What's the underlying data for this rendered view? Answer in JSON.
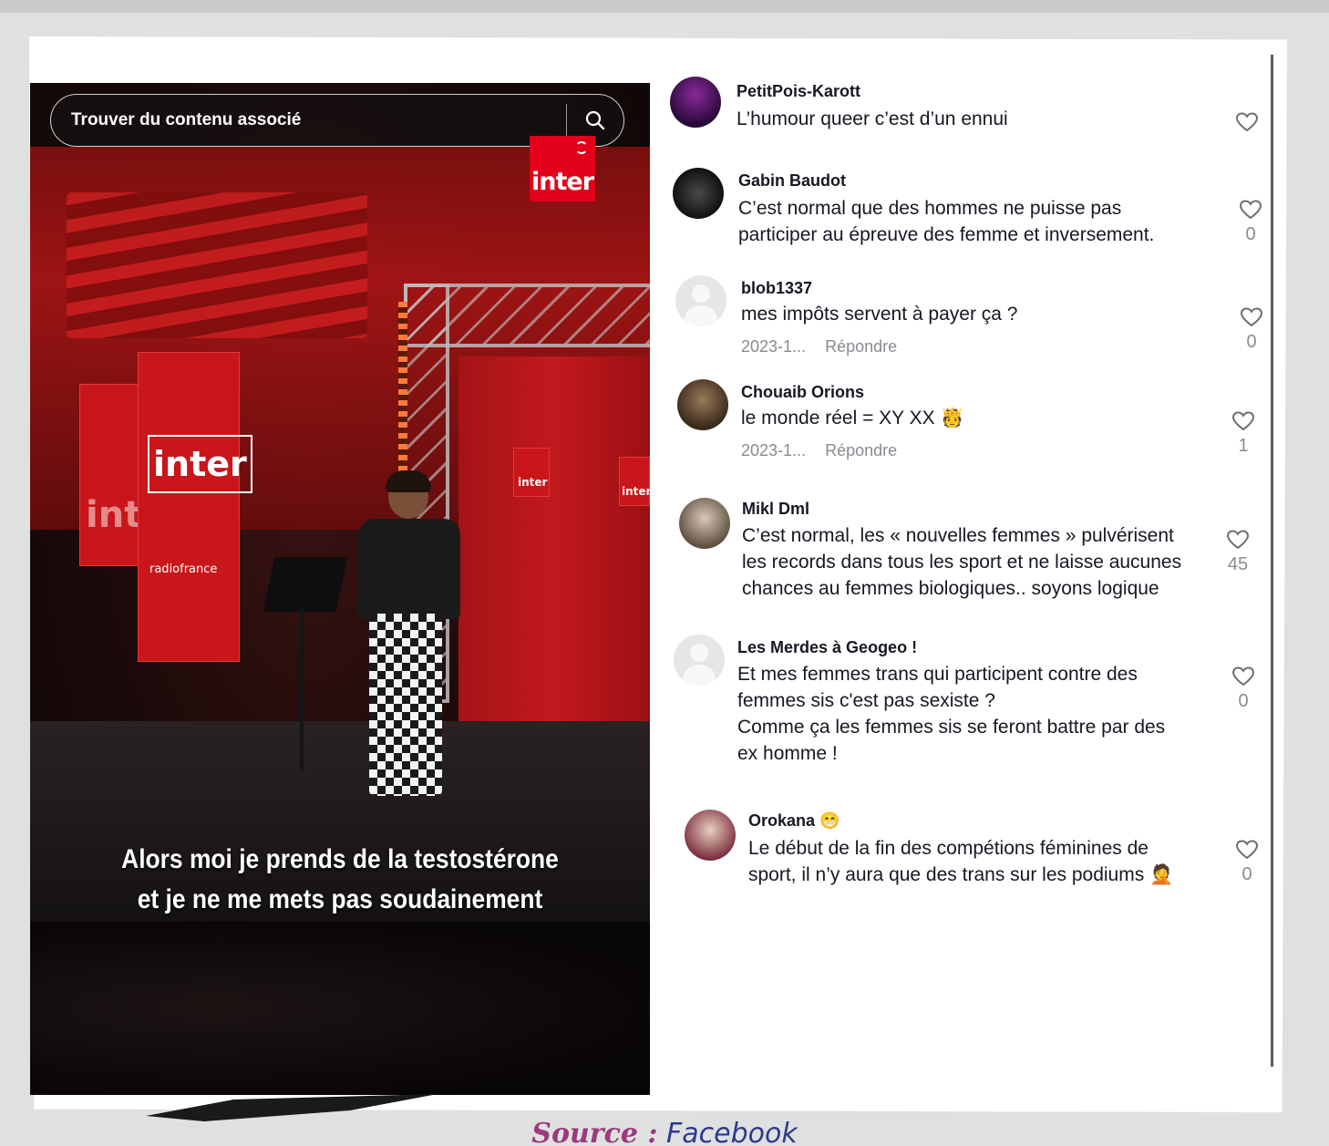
{
  "video": {
    "search_placeholder": "Trouver du contenu associé",
    "logo_text": "inter",
    "subtitle_line1": "Alors moi je prends de la testostérone",
    "subtitle_line2": "et je ne me mets pas soudainement",
    "banner_text": "inter",
    "banner_sub": "radiofrance"
  },
  "comments": [
    {
      "user": "PetitPois-Karott",
      "text": "L’humour queer c’est d’un ennui",
      "date": "",
      "reply": "",
      "likes": ""
    },
    {
      "user": "Gabin Baudot",
      "text": "C’est normal que des hommes ne puisse pas\nparticiper au épreuve des femme et inversement.",
      "date": "",
      "reply": "",
      "likes": "0"
    },
    {
      "user": "blob1337",
      "text": "mes impôts servent à payer ça ?",
      "date": "2023-1...",
      "reply": "Répondre",
      "likes": "0"
    },
    {
      "user": "Chouaib Orions",
      "text": "le monde réel = XY XX 🫅",
      "date": "2023-1...",
      "reply": "Répondre",
      "likes": "1"
    },
    {
      "user": "Mikl Dml",
      "text": "C’est normal, les « nouvelles femmes » pulvérisent\nles records dans tous les sport et ne laisse aucunes\nchances au femmes biologiques.. soyons logique",
      "date": "",
      "reply": "",
      "likes": "45"
    },
    {
      "user": "Les Merdes à Geogeo !",
      "text": "Et mes femmes trans qui participent contre des\nfemmes sis c'est pas sexiste ?\nComme ça les femmes sis se feront battre par des\nex homme !",
      "date": "",
      "reply": "",
      "likes": "0"
    },
    {
      "user": "Orokana 😁",
      "text": "Le début de la fin des compétions féminines de\nsport, il n’y aura que des trans sur les podiums 🤦",
      "date": "",
      "reply": "",
      "likes": "0"
    }
  ],
  "source": {
    "label": "Source :",
    "value": "Facebook"
  }
}
